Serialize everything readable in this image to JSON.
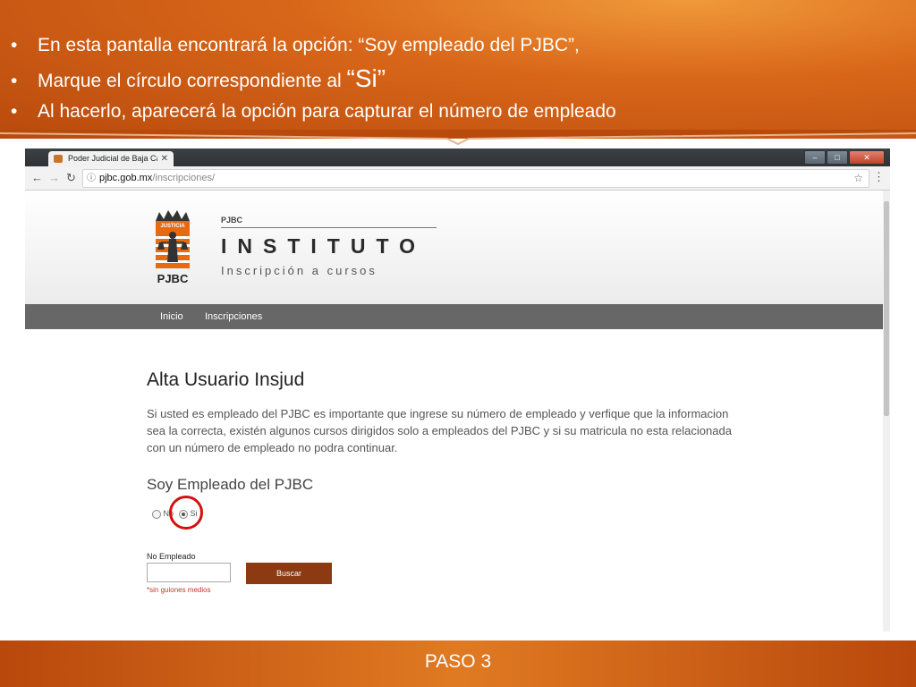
{
  "slide": {
    "bullets": [
      {
        "text": "En esta pantalla encontrará la opción: “Soy empleado del PJBC”,"
      },
      {
        "text": "Marque el círculo correspondiente al ",
        "emph": "“Si”"
      },
      {
        "text": "Al hacerlo, aparecerá la opción para capturar el número de empleado"
      }
    ],
    "footer": "PASO 3",
    "colors": {
      "header": "#d9671a",
      "highlight_circle": "#d40f0f"
    }
  },
  "browser": {
    "tab_title": "Poder Judicial de Baja Ca",
    "url_domain": "pjbc.gob.mx",
    "url_path": "/inscripciones/",
    "icons": [
      "favicon-icon",
      "tab-close-icon",
      "minimize-icon",
      "maximize-icon",
      "window-close-icon",
      "back-arrow-icon",
      "forward-arrow-icon",
      "reload-icon",
      "info-icon",
      "star-icon",
      "menu-icon"
    ]
  },
  "site": {
    "logo_text": "PJBC",
    "logo_banner": "JUSTICIA",
    "brand_small": "PJBC",
    "brand_title": "INSTITUTO",
    "brand_sub": "Inscripción a cursos",
    "nav": [
      "Inicio",
      "Inscripciones"
    ]
  },
  "page": {
    "title": "Alta Usuario Insjud",
    "intro": "Si usted es empleado del PJBC es importante que ingrese su número de empleado y verfique que la informacion sea la correcta, existén algunos cursos dirigidos solo a empleados del PJBC y si su matricula no esta relacionada con un número de empleado no podra continuar.",
    "employee_question": "Soy Empleado del PJBC",
    "radio_no": "No",
    "radio_si": "Si",
    "selected": "Si",
    "field_label": "No Empleado",
    "field_value": "",
    "button": "Buscar",
    "hint": "*sin guiones medios",
    "colors": {
      "nav_bar": "#676767",
      "button": "#8b3a12",
      "hint": "#c0392b"
    }
  }
}
